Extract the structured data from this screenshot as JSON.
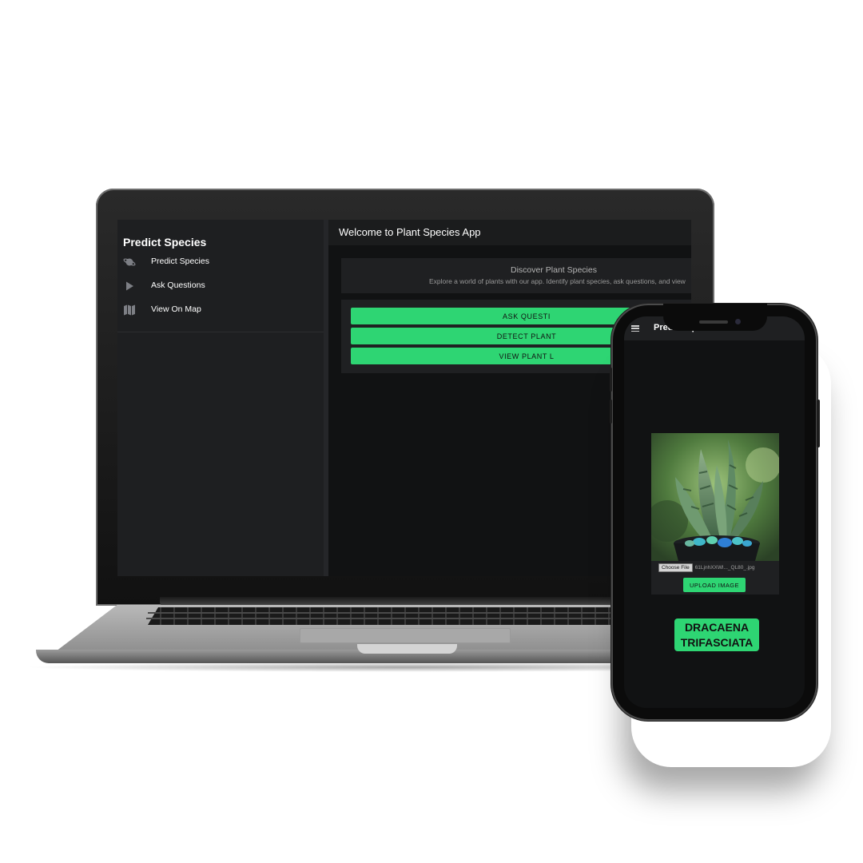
{
  "desktop": {
    "sidebar": {
      "title": "Predict Species",
      "items": [
        {
          "label": "Predict Species",
          "icon": "planet-icon"
        },
        {
          "label": "Ask Questions",
          "icon": "play-icon"
        },
        {
          "label": "View On Map",
          "icon": "map-icon"
        }
      ]
    },
    "header": {
      "title": "Welcome to Plant Species App"
    },
    "intro": {
      "heading": "Discover Plant Species",
      "text": "Explore a world of plants with our app. Identify plant species, ask questions, and view"
    },
    "actions": [
      {
        "label": "ASK QUESTI"
      },
      {
        "label": "DETECT PLANT"
      },
      {
        "label": "VIEW PLANT L"
      }
    ]
  },
  "mobile": {
    "header": {
      "title": "Predict Species",
      "menu_icon": "hamburger-icon"
    },
    "upload": {
      "choose_label": "Choose File",
      "file_name": "61LjnhXXWl..._QL80_.jpg",
      "upload_label": "UPLOAD IMAGE"
    },
    "result": {
      "line1": "DRACAENA",
      "line2": "TRIFASCIATA"
    }
  },
  "colors": {
    "accent": "#2ed573",
    "background": "#111213",
    "panel": "#1f2022"
  }
}
